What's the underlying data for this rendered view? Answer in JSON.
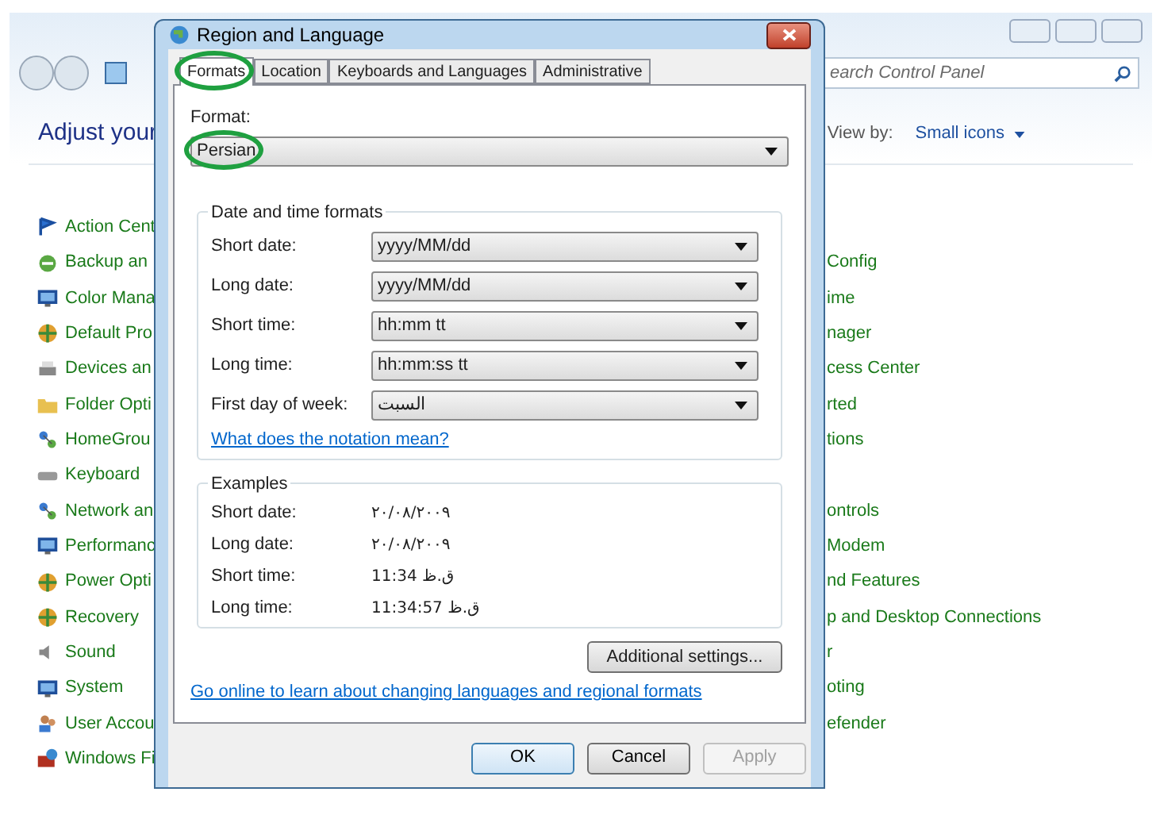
{
  "control_panel": {
    "search": {
      "placeholder": "earch Control Panel"
    },
    "heading": "Adjust your",
    "view_by": {
      "label": "View by:",
      "value": "Small icons"
    },
    "rows": [
      {
        "left": "Action Cent"
      },
      {
        "left": "Backup an",
        "right": "Config"
      },
      {
        "left": "Color Mana",
        "right": "ime"
      },
      {
        "left": "Default Pro",
        "right": "nager"
      },
      {
        "left": "Devices an",
        "right": "cess Center"
      },
      {
        "left": "Folder Opti",
        "right": "rted"
      },
      {
        "left": "HomeGrou",
        "right": "tions"
      },
      {
        "left": "Keyboard"
      },
      {
        "left": "Network an",
        "right": "ontrols"
      },
      {
        "left": "Performanc",
        "right": "Modem"
      },
      {
        "left": "Power Opti",
        "right": "nd Features"
      },
      {
        "left": "Recovery",
        "right": "p and Desktop Connections"
      },
      {
        "left": "Sound",
        "right": "r"
      },
      {
        "left": "System",
        "right": "oting"
      },
      {
        "left": "User Accou",
        "right": "efender"
      },
      {
        "left": "Windows Fi"
      }
    ]
  },
  "dialog": {
    "title": "Region and Language",
    "tabs": [
      {
        "label": "Formats",
        "selected": true,
        "circled": true
      },
      {
        "label": "Location",
        "selected": false,
        "circled": false
      },
      {
        "label": "Keyboards and Languages",
        "selected": false,
        "circled": false
      },
      {
        "label": "Administrative",
        "selected": false,
        "circled": false
      }
    ],
    "format": {
      "label": "Format:",
      "value": "Persian",
      "circled": true
    },
    "date_time_group": {
      "title": "Date and time formats",
      "fields": [
        {
          "label": "Short date:",
          "value": "yyyy/MM/dd"
        },
        {
          "label": "Long date:",
          "value": "yyyy/MM/dd"
        },
        {
          "label": "Short time:",
          "value": "hh:mm tt"
        },
        {
          "label": "Long time:",
          "value": "hh:mm:ss tt"
        },
        {
          "label": "First day of week:",
          "value": "السبت"
        }
      ],
      "link": "What does the notation mean?"
    },
    "examples": {
      "title": "Examples",
      "rows": [
        {
          "label": "Short date:",
          "value": "٢٠/٠٨/٢٠٠٩"
        },
        {
          "label": "Long date:",
          "value": "٢٠/٠٨/٢٠٠٩"
        },
        {
          "label": "Short time:",
          "value": "11:34 ق.ظ"
        },
        {
          "label": "Long time:",
          "value": "11:34:57 ق.ظ"
        }
      ]
    },
    "additional_button": "Additional settings...",
    "online_link": "Go online to learn about changing languages and regional formats",
    "buttons": [
      {
        "label": "OK",
        "disabled": false,
        "default": true
      },
      {
        "label": "Cancel",
        "disabled": false,
        "default": false
      },
      {
        "label": "Apply",
        "disabled": true,
        "default": false
      }
    ]
  }
}
